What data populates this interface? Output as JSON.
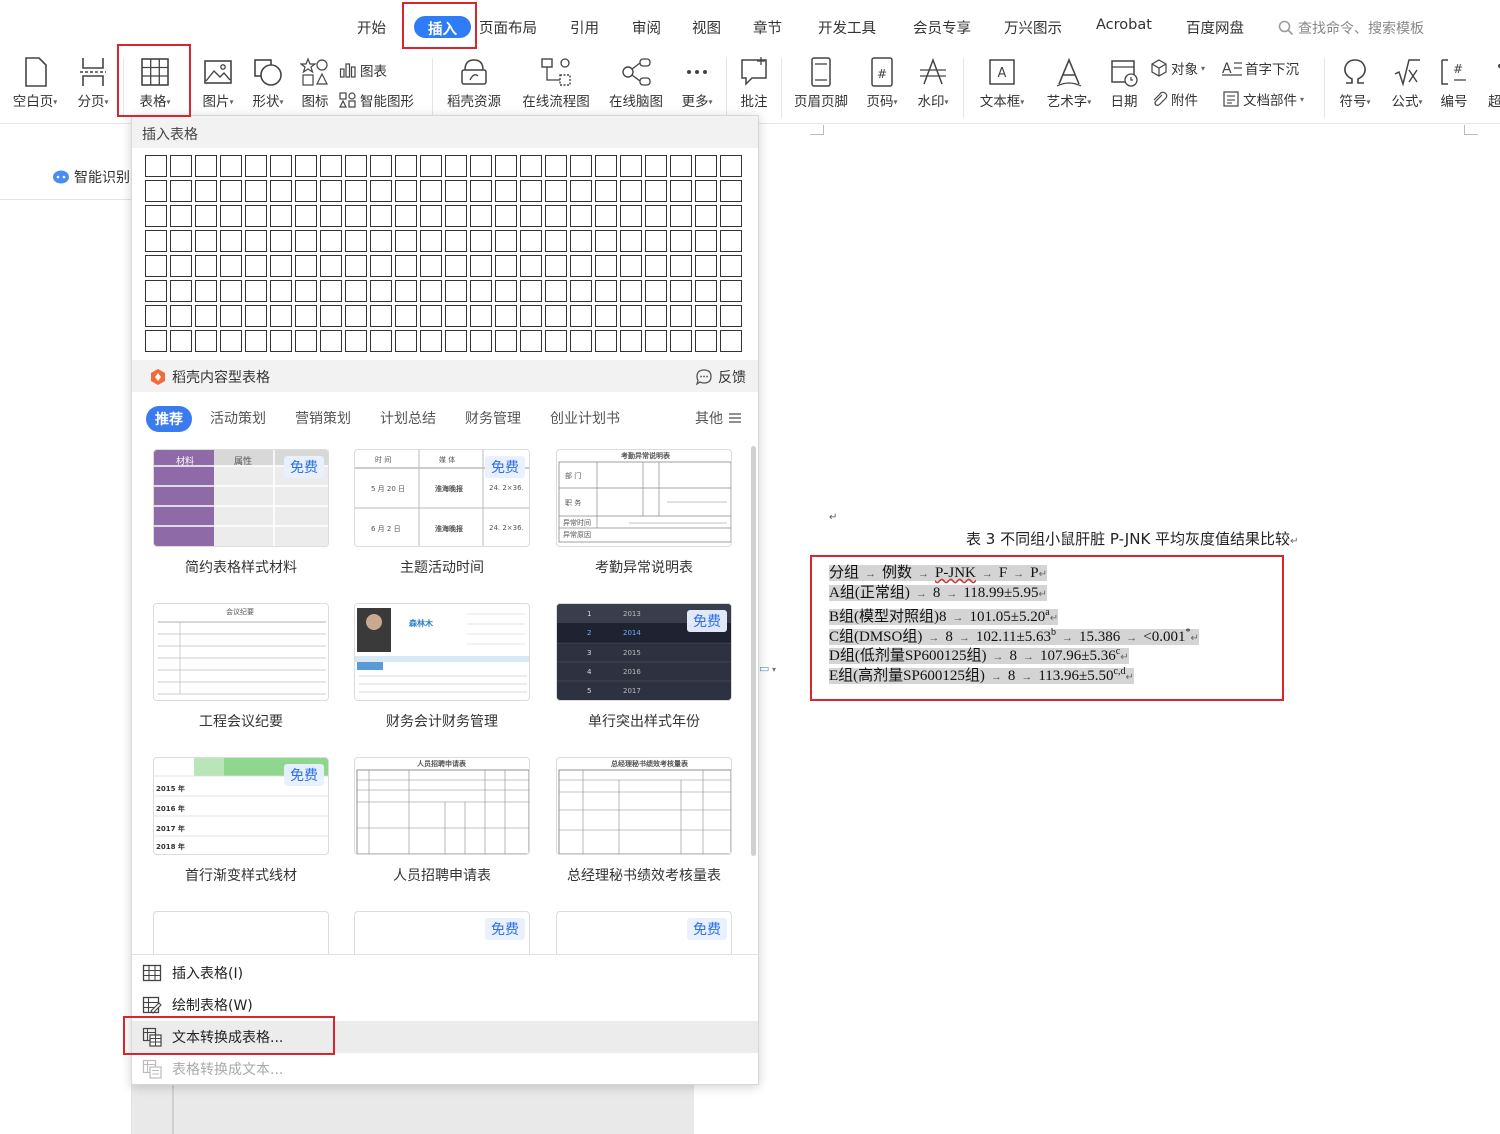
{
  "tabs": [
    "开始",
    "插入",
    "页面布局",
    "引用",
    "审阅",
    "视图",
    "章节",
    "开发工具",
    "会员专享",
    "万兴图示",
    "Acrobat",
    "百度网盘"
  ],
  "active_tab": "插入",
  "search": {
    "placeholder": "查找命令、搜索模板"
  },
  "ribbon": {
    "blank_page": "空白页",
    "page_break": "分页",
    "table": "表格",
    "picture": "图片",
    "shape": "形状",
    "icon": "图标",
    "chart": "图表",
    "smart_graphic": "智能图形",
    "docer_resource": "稻壳资源",
    "online_flowchart": "在线流程图",
    "online_mindmap": "在线脑图",
    "more": "更多",
    "comment": "批注",
    "header_footer": "页眉页脚",
    "page_number": "页码",
    "watermark": "水印",
    "textbox": "文本框",
    "wordart": "艺术字",
    "date": "日期",
    "object": "对象",
    "attachment": "附件",
    "drop_cap": "首字下沉",
    "doc_parts": "文档部件",
    "symbol": "符号",
    "formula": "公式",
    "numbering": "编号",
    "overflow": "超"
  },
  "left_panel": {
    "smart_recognition": "智能识别"
  },
  "dropdown": {
    "title": "插入表格",
    "grid": {
      "rows": 8,
      "cols": 24
    },
    "docer_title": "稻壳内容型表格",
    "feedback": "反馈",
    "categories": [
      "推荐",
      "活动策划",
      "营销策划",
      "计划总结",
      "财务管理",
      "创业计划书"
    ],
    "other": "其他",
    "free_badge": "免费",
    "templates": [
      {
        "name": "简约表格样式材料",
        "free": true
      },
      {
        "name": "主题活动时间",
        "free": true
      },
      {
        "name": "考勤异常说明表",
        "free": false
      },
      {
        "name": "工程会议纪要",
        "free": false
      },
      {
        "name": "财务会计财务管理",
        "free": false
      },
      {
        "name": "单行突出样式年份",
        "free": true
      },
      {
        "name": "首行渐变样式线材",
        "free": true
      },
      {
        "name": "人员招聘申请表",
        "free": false
      },
      {
        "name": "总经理秘书绩效考核量表",
        "free": false
      }
    ],
    "menu": {
      "insert_table": "插入表格(I)",
      "draw_table": "绘制表格(W)",
      "text_to_table": "文本转换成表格...",
      "table_to_text": "表格转换成文本..."
    },
    "thumb_text": {
      "t1_h1": "材料",
      "t1_h2": "属性",
      "t2_h1": "时 间",
      "t2_h2": "媒 体",
      "t2_r1a": "5 月 20 日",
      "t2_r1b": "淮海晚报",
      "t2_r1c": "24. 2×36.",
      "t2_r2a": "6 月 2 日",
      "t2_r2b": "淮海晚报",
      "t2_r2c": "24. 2×36.",
      "t3_title": "考勤异常说明表",
      "t3_r1": "部 门",
      "t3_r2": "职 务",
      "t3_r3": "异常时间",
      "t3_r4": "异常原因",
      "t4_title": "会议纪要",
      "t5_name": "森林木",
      "t6_rows": [
        "1",
        "2",
        "3",
        "4",
        "5"
      ],
      "t6_years": [
        "2013",
        "2014",
        "2015",
        "2016",
        "2017"
      ],
      "t7_years": [
        "2015 年",
        "2016 年",
        "2017 年",
        "2018 年"
      ],
      "t8_title": "人员招聘申请表",
      "t9_title": "总经理秘书绩效考核量表"
    }
  },
  "document": {
    "caption": "表 3 不同组小鼠肝脏 P-JNK 平均灰度值结果比较",
    "lines": [
      {
        "a": "分组",
        "b": "例数",
        "c": "P-JNK",
        "d": "F",
        "e": "P"
      },
      {
        "a": "A组(正常组)",
        "b": "8",
        "c": "118.99±5.95"
      },
      {
        "a": "B组(模型对照组)",
        "b": "8",
        "c": "101.05±5.20",
        "sup": "a"
      },
      {
        "a": "C组(DMSO组)",
        "b": "8",
        "c": "102.11±5.63",
        "sup": "b",
        "d": "15.386",
        "e": "<0.001",
        "esup": "*"
      },
      {
        "a": "D组(低剂量SP600125组)",
        "b": "8",
        "c": "107.96±5.36",
        "sup": "c"
      },
      {
        "a": "E组(高剂量SP600125组)",
        "b": "8",
        "c": "113.96±5.50",
        "sup": "c,d"
      }
    ]
  },
  "colors": {
    "accent": "#2e7cf6",
    "annotation_red": "#d9262c",
    "selection_gray": "#d4d4d4",
    "docer_orange": "#f06a3a",
    "badge_blue": "#2d6fe8"
  }
}
